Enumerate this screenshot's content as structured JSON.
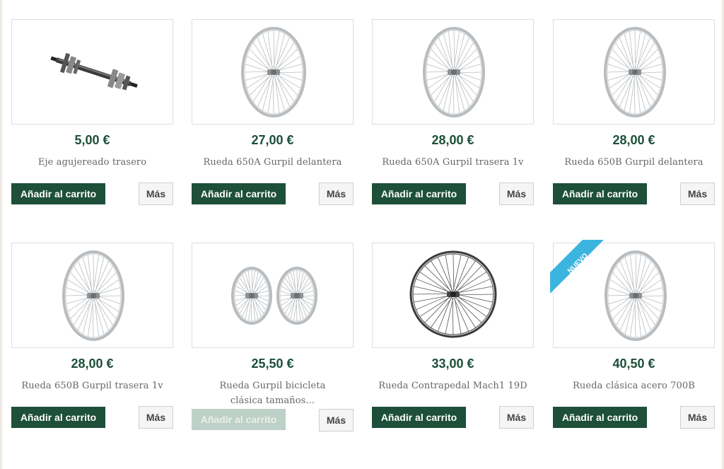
{
  "products": [
    {
      "price": "5,00 €",
      "name": "Eje agujereado trasero",
      "cart_label": "Añadir al carrito",
      "more_label": "Más",
      "image": "axle-image"
    },
    {
      "price": "27,00 €",
      "name": "Rueda 650A Gurpil delantera",
      "cart_label": "Añadir al carrito",
      "more_label": "Más",
      "image": "wheel-image"
    },
    {
      "price": "28,00 €",
      "name": "Rueda 650A Gurpil trasera 1v",
      "cart_label": "Añadir al carrito",
      "more_label": "Más",
      "image": "wheel-image"
    },
    {
      "price": "28,00 €",
      "name": "Rueda 650B Gurpil delantera",
      "cart_label": "Añadir al carrito",
      "more_label": "Más",
      "image": "wheel-image"
    },
    {
      "price": "28,00 €",
      "name": "Rueda 650B Gurpil trasera 1v",
      "cart_label": "Añadir al carrito",
      "more_label": "Más",
      "image": "wheel-image"
    },
    {
      "price": "25,50 €",
      "name": "Rueda Gurpil bicicleta clásica tamaños...",
      "cart_label": "Añadir al carrito",
      "more_label": "Más",
      "image": "wheel-pair-image",
      "cart_disabled": true
    },
    {
      "price": "33,00 €",
      "name": "Rueda Contrapedal Mach1 19D",
      "cart_label": "Añadir al carrito",
      "more_label": "Más",
      "image": "dark-wheel-image"
    },
    {
      "price": "40,50 €",
      "name": "Rueda clásica acero 700B",
      "cart_label": "Añadir al carrito",
      "more_label": "Más",
      "image": "wheel-image",
      "badge": "NUEVO"
    }
  ],
  "colors": {
    "brand": "#1d4f3a",
    "disabled": "#bdd1c8",
    "badge": "#3cb4e0"
  }
}
